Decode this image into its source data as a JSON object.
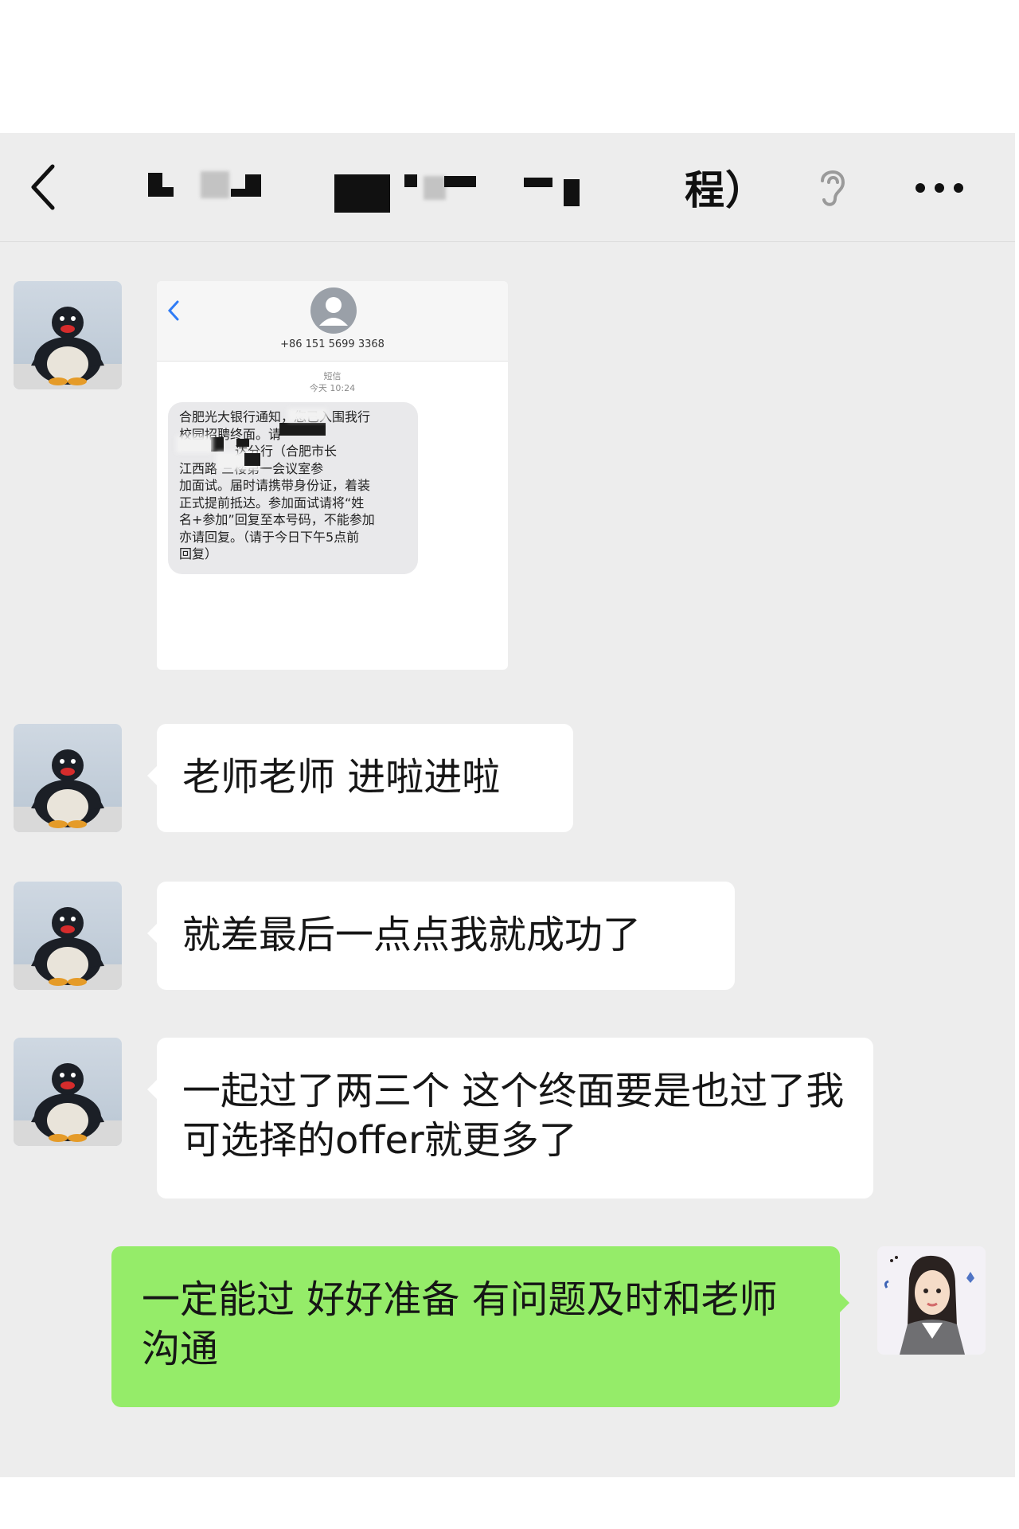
{
  "header": {
    "title_visible": "程）",
    "back_icon": "chevron-left-icon",
    "ear_icon": "ear-icon",
    "more_icon": "more-icon"
  },
  "messages": [
    {
      "type": "image",
      "sender": "contact",
      "screenshot": {
        "phone_number": "+86 151 5699 3368",
        "channel": "短信",
        "time": "今天 10:24",
        "sms_lines": [
          "合肥光大银行通知，您已入围我行",
          "校园招聘终面。请",
          "达分行（合肥市长",
          "江西路 三楼第一会议室参",
          "加面试。届时请携带身份证，着装",
          "正式提前抵达。参加面试请将“姓",
          "名+参加”回复至本号码，不能参加",
          "亦请回复。（请于今日下午5点前",
          "回复）"
        ]
      }
    },
    {
      "type": "text",
      "sender": "contact",
      "text": "老师老师 进啦进啦"
    },
    {
      "type": "text",
      "sender": "contact",
      "text": "就差最后一点点我就成功了"
    },
    {
      "type": "text",
      "sender": "contact",
      "text": "一起过了两三个 这个终面要是也过了我可选择的offer就更多了"
    },
    {
      "type": "text",
      "sender": "me",
      "text": "一定能过 好好准备 有问题及时和老师沟通"
    }
  ],
  "colors": {
    "chat_background": "#ededed",
    "incoming_bubble": "#ffffff",
    "outgoing_bubble": "#95ec69",
    "text": "#161616"
  }
}
